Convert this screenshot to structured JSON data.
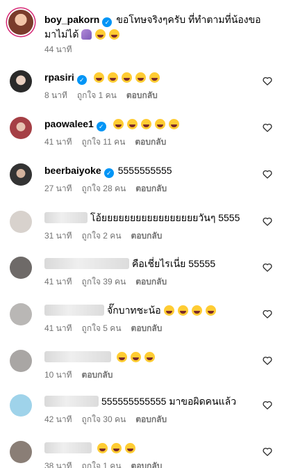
{
  "post": {
    "username": "boy_pakorn",
    "caption": "ขอโทษจริงๆครับ ที่ทำตามที่น้องขอมาไม่ได้",
    "time": "44 นาที"
  },
  "comments": [
    {
      "username": "rpasiri",
      "verified": true,
      "text": "",
      "emoji_count": 5,
      "time": "8 นาที",
      "likes": "ถูกใจ 1 คน",
      "reply": "ตอบกลับ"
    },
    {
      "username": "paowalee1",
      "verified": true,
      "text": "",
      "emoji_count": 5,
      "time": "41 นาที",
      "likes": "ถูกใจ 11 คน",
      "reply": "ตอบกลับ"
    },
    {
      "username": "beerbaiyoke",
      "verified": true,
      "text": "5555555555",
      "emoji_count": 0,
      "time": "27 นาที",
      "likes": "ถูกใจ 28 คน",
      "reply": "ตอบกลับ"
    },
    {
      "username": "",
      "verified": false,
      "text": "โอ้ยยยยยยยยยยยยยยยยยวันๆ 5555",
      "emoji_count": 0,
      "time": "31 นาที",
      "likes": "ถูกใจ 2 คน",
      "reply": "ตอบกลับ"
    },
    {
      "username": "",
      "verified": false,
      "text": "คือเชี่ยไรเนี่ย 55555",
      "emoji_count": 0,
      "time": "41 นาที",
      "likes": "ถูกใจ 39 คน",
      "reply": "ตอบกลับ"
    },
    {
      "username": "",
      "verified": false,
      "text": "จั๊กบาทชะน้อ",
      "emoji_count": 4,
      "time": "41 นาที",
      "likes": "ถูกใจ 5 คน",
      "reply": "ตอบกลับ"
    },
    {
      "username": "",
      "verified": false,
      "text": "",
      "emoji_count": 3,
      "time": "10 นาที",
      "likes": "",
      "reply": "ตอบกลับ"
    },
    {
      "username": "",
      "verified": false,
      "text": "555555555555 มาขอผิดคนแล้ว",
      "emoji_count": 0,
      "time": "42 นาที",
      "likes": "ถูกใจ 30 คน",
      "reply": "ตอบกลับ"
    },
    {
      "username": "",
      "verified": false,
      "text": "",
      "emoji_count": 3,
      "time": "38 นาที",
      "likes": "ถูกใจ 1 คน",
      "reply": "ตอบกลับ"
    }
  ],
  "icons": {
    "verified": "verified-badge-icon",
    "like": "heart-icon",
    "emoji": "laughing-face-emoji"
  },
  "colors": {
    "verified": "#0095f6",
    "meta": "#737373",
    "story_ring": "#d62976"
  }
}
